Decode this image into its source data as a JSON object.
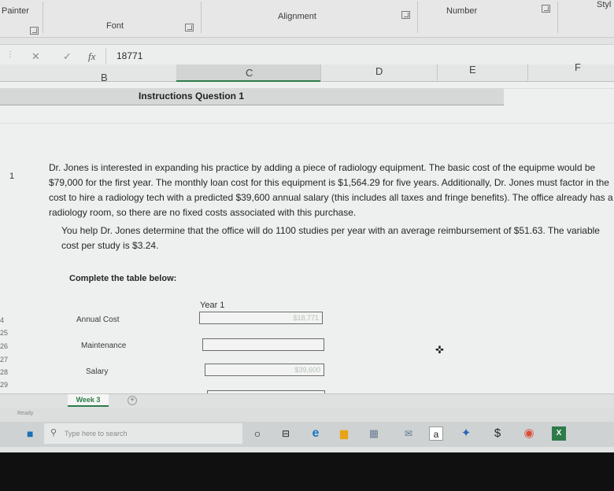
{
  "ribbon": {
    "clipboard_label": "Painter",
    "font_group": "Font",
    "alignment_group": "Alignment",
    "number_group": "Number",
    "styles_group": "Styl"
  },
  "formula_bar": {
    "cancel_icon": "cancel-icon",
    "enter_icon": "check-icon",
    "fx_label": "fx",
    "value": "18771"
  },
  "columns": [
    "B",
    "C",
    "D",
    "E",
    "F"
  ],
  "sheet": {
    "instructions_title": "Instructions Question 1",
    "row_number": "1",
    "paragraph_1": "Dr. Jones is interested in expanding his practice by adding a piece of radiology equipment. The basic cost of the equipme would be $79,000 for the first year. The monthly loan cost for this equipment is $1,564.29 for five years. Additionally, Dr. Jones must factor in the cost to hire a radiology tech with a predicted $39,600 annual salary (this includes all taxes and fringe benefits). The office already has a radiology room, so there are no fixed costs associated with this purchase.",
    "paragraph_2": "You help Dr. Jones determine that the office will do 1100 studies per year with an average reimbursement of $51.63. The variable cost per study is $3.24.",
    "complete_label": "Complete the table below:",
    "table": {
      "year_header": "Year 1",
      "rows": [
        {
          "label": "Annual Cost",
          "value": "$18,771"
        },
        {
          "label": "Maintenance",
          "value": ""
        },
        {
          "label": "Salary",
          "value": "$39,600"
        }
      ]
    },
    "row_numbers": [
      "4",
      "25",
      "26",
      "27",
      "28",
      "29"
    ]
  },
  "tabs": {
    "active": "Week 3",
    "add_label": "+"
  },
  "status": {
    "text": "Ready"
  },
  "taskbar": {
    "search_placeholder": "Type here to search"
  },
  "colors": {
    "excel_green": "#2e7b49",
    "taskbar_bg": "#cfd2d3"
  }
}
